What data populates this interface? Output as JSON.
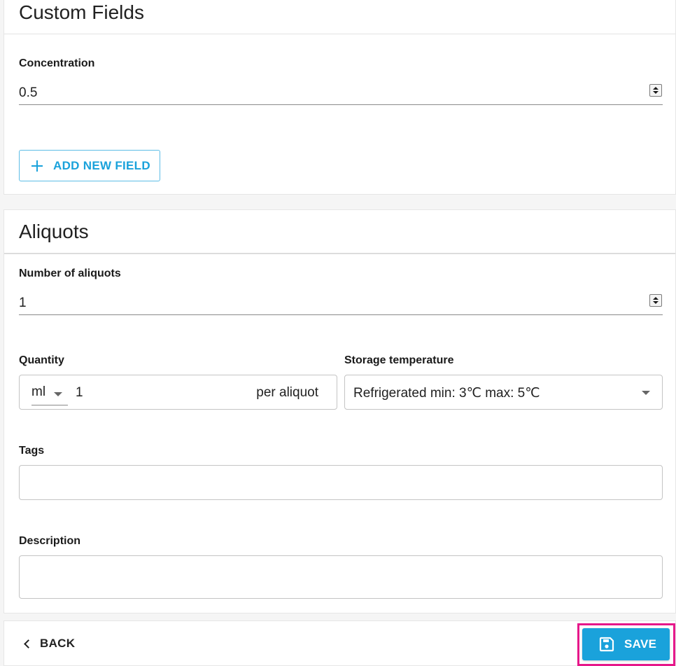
{
  "custom_fields": {
    "title": "Custom Fields",
    "concentration": {
      "label": "Concentration",
      "value": "0.5"
    },
    "add_button_label": "ADD NEW FIELD"
  },
  "aliquots": {
    "title": "Aliquots",
    "number_of_aliquots": {
      "label": "Number of aliquots",
      "value": "1"
    },
    "quantity": {
      "label": "Quantity",
      "unit": "ml",
      "value": "1",
      "suffix": "per aliquot"
    },
    "storage_temperature": {
      "label": "Storage temperature",
      "value": "Refrigerated min: 3℃ max: 5℃"
    },
    "tags": {
      "label": "Tags",
      "value": ""
    },
    "description": {
      "label": "Description",
      "value": ""
    }
  },
  "footer": {
    "back_label": "BACK",
    "save_label": "SAVE"
  },
  "colors": {
    "accent": "#1aa2db",
    "highlight": "#e6178a"
  },
  "icons": [
    "plus-icon",
    "chevron-left-icon",
    "save-icon",
    "dropdown-caret-icon",
    "spinner-icon"
  ]
}
